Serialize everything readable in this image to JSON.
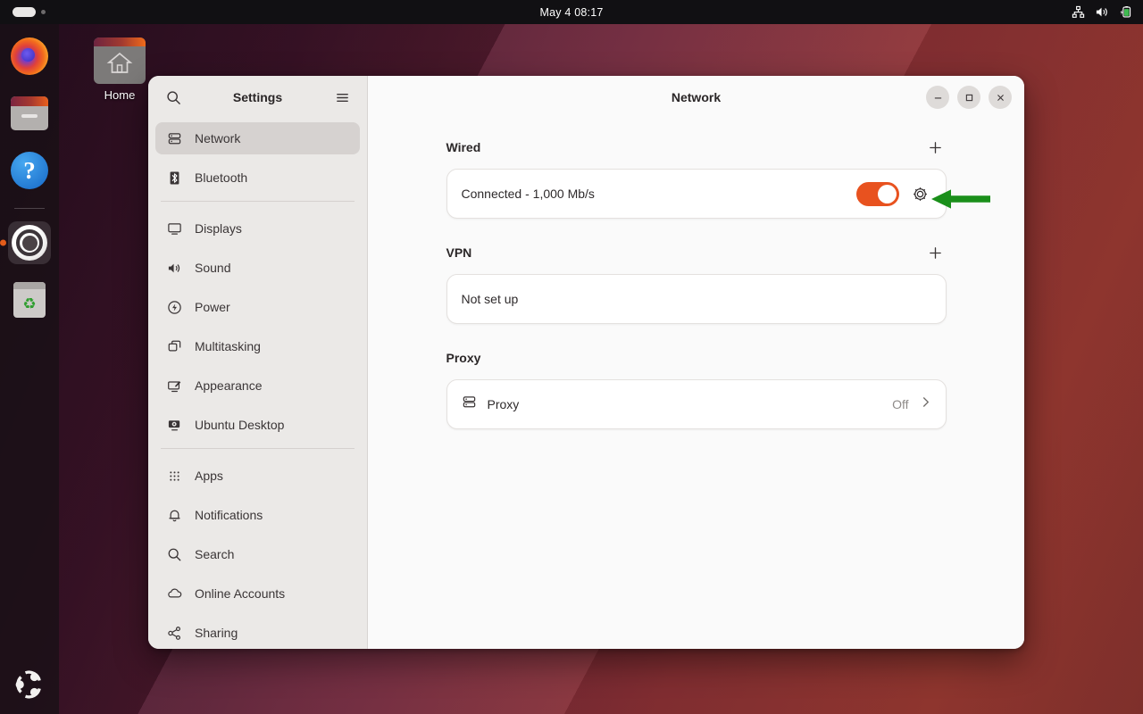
{
  "topbar": {
    "clock": "May 4  08:17",
    "icons": [
      "network-wired-icon",
      "volume-icon",
      "battery-charging-icon"
    ],
    "window_indicator": "window-list-indicator"
  },
  "dock": {
    "items": [
      {
        "name": "firefox",
        "label": "Firefox",
        "active": false
      },
      {
        "name": "files",
        "label": "Files",
        "active": false
      },
      {
        "name": "help",
        "label": "Help",
        "active": false
      },
      {
        "name": "settings",
        "label": "Settings",
        "active": true
      },
      {
        "name": "trash",
        "label": "Trash",
        "active": false
      }
    ],
    "show_apps_label": "Show Applications"
  },
  "desktop": {
    "home_icon_label": "Home"
  },
  "sidebar": {
    "title": "Settings",
    "search_icon": "search-icon",
    "menu_icon": "hamburger-menu-icon",
    "groups": [
      {
        "items": [
          {
            "label": "Network",
            "icon": "network-icon",
            "selected": true
          },
          {
            "label": "Bluetooth",
            "icon": "bluetooth-icon",
            "selected": false
          }
        ]
      },
      {
        "items": [
          {
            "label": "Displays",
            "icon": "display-icon",
            "selected": false
          },
          {
            "label": "Sound",
            "icon": "sound-icon",
            "selected": false
          },
          {
            "label": "Power",
            "icon": "power-icon",
            "selected": false
          },
          {
            "label": "Multitasking",
            "icon": "multitasking-icon",
            "selected": false
          },
          {
            "label": "Appearance",
            "icon": "appearance-icon",
            "selected": false
          },
          {
            "label": "Ubuntu Desktop",
            "icon": "ubuntu-desktop-icon",
            "selected": false
          }
        ]
      },
      {
        "items": [
          {
            "label": "Apps",
            "icon": "apps-grid-icon",
            "selected": false
          },
          {
            "label": "Notifications",
            "icon": "bell-icon",
            "selected": false
          },
          {
            "label": "Search",
            "icon": "search-icon",
            "selected": false
          },
          {
            "label": "Online Accounts",
            "icon": "cloud-icon",
            "selected": false
          },
          {
            "label": "Sharing",
            "icon": "share-icon",
            "selected": false
          }
        ]
      }
    ]
  },
  "window": {
    "title": "Network",
    "minimize_label": "Minimize",
    "maximize_label": "Maximize",
    "close_label": "Close"
  },
  "panel": {
    "wired": {
      "heading": "Wired",
      "add_label": "+",
      "status": "Connected - 1,000 Mb/s",
      "toggle_state": "on",
      "settings_icon": "gear-icon"
    },
    "vpn": {
      "heading": "VPN",
      "add_label": "+",
      "status": "Not set up"
    },
    "proxy": {
      "heading": "Proxy",
      "row_label": "Proxy",
      "row_icon": "proxy-icon",
      "value": "Off",
      "chevron": "chevron-right-icon"
    }
  },
  "annotation": {
    "arrow": "green-pointer-arrow",
    "color": "#1a8f1a",
    "points_to": "wired-settings-gear-button"
  }
}
